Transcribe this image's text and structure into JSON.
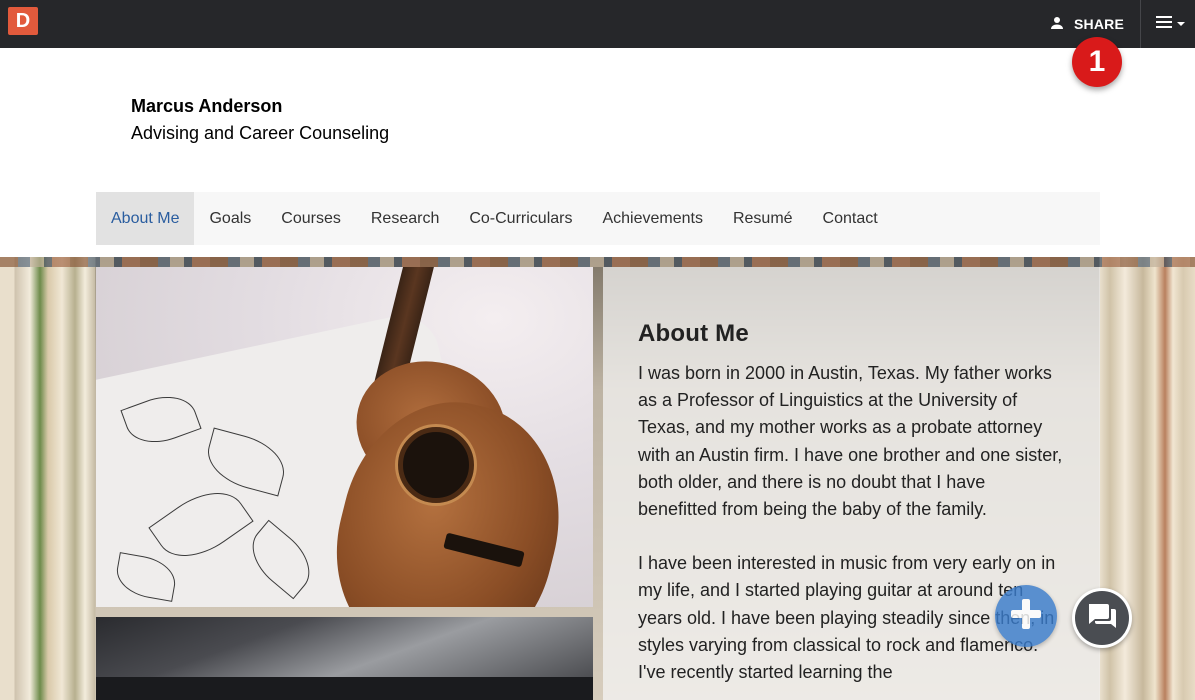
{
  "topbar": {
    "logo_letter": "D",
    "share_label": "SHARE",
    "menu_icon": "hamburger-icon"
  },
  "badge": {
    "number": "1",
    "color": "#d91a1a"
  },
  "header": {
    "name": "Marcus Anderson",
    "department": "Advising and Career Counseling"
  },
  "nav": {
    "active_color": "#2a5d9f",
    "items": [
      {
        "label": "About Me",
        "active": true
      },
      {
        "label": "Goals"
      },
      {
        "label": "Courses"
      },
      {
        "label": "Research"
      },
      {
        "label": "Co-Curriculars"
      },
      {
        "label": "Achievements"
      },
      {
        "label": "Resumé"
      },
      {
        "label": "Contact"
      }
    ]
  },
  "about": {
    "heading": "About Me",
    "paragraphs": [
      "I was born in 2000 in Austin, Texas. My father works as a Professor of Linguistics at the University of Texas, and my mother works as a probate attorney with an Austin firm. I have one brother and one sister, both older, and there is no doubt that I have benefitted from being the baby of the family.",
      "I have been interested in music from very early on in my life, and I started playing guitar at around ten years old. I have been playing steadily since then, in styles varying from classical to rock and flamenco. I've recently started learning the"
    ]
  },
  "floating": {
    "add_icon": "plus-icon",
    "chat_icon": "chat-icon"
  },
  "colors": {
    "topbar_bg": "#26272a",
    "logo_bg": "#e25a3c",
    "add_button": "#3a7ccb"
  }
}
